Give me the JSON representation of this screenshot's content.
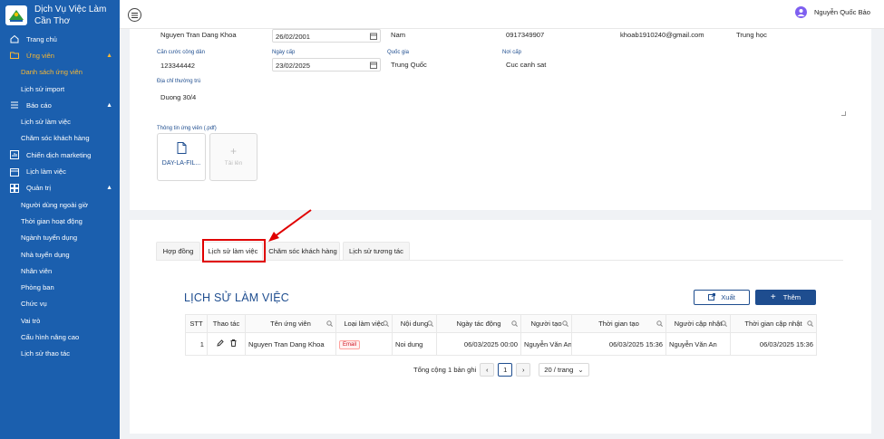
{
  "brand": {
    "line1": "Dịch Vụ Việc Làm",
    "line2": "Cần Thơ"
  },
  "sidebar": {
    "items": [
      {
        "label": "Trang chủ",
        "icon": "home-icon",
        "level": "top"
      },
      {
        "label": "Ứng viên",
        "icon": "folder-icon",
        "level": "top",
        "active": true,
        "caret": "▲"
      },
      {
        "label": "Danh sách ứng viên",
        "level": "sub",
        "active": true
      },
      {
        "label": "Lịch sử import",
        "level": "sub"
      },
      {
        "label": "Báo cáo",
        "icon": "menu-icon",
        "level": "top",
        "caret": "▲"
      },
      {
        "label": "Lịch sử làm việc",
        "level": "sub"
      },
      {
        "label": "Chăm sóc khách hàng",
        "level": "sub"
      },
      {
        "label": "Chiến dịch marketing",
        "icon": "chart-icon",
        "level": "top"
      },
      {
        "label": "Lịch làm việc",
        "icon": "calendar-icon",
        "level": "top"
      },
      {
        "label": "Quản trị",
        "icon": "grid-icon",
        "level": "top",
        "caret": "▲"
      },
      {
        "label": "Người dùng ngoài giờ",
        "level": "sub"
      },
      {
        "label": "Thời gian hoạt động",
        "level": "sub"
      },
      {
        "label": "Ngành tuyển dụng",
        "level": "sub"
      },
      {
        "label": "Nhà tuyển dụng",
        "level": "sub"
      },
      {
        "label": "Nhân viên",
        "level": "sub"
      },
      {
        "label": "Phòng ban",
        "level": "sub"
      },
      {
        "label": "Chức vụ",
        "level": "sub"
      },
      {
        "label": "Vai trò",
        "level": "sub"
      },
      {
        "label": "Cấu hình nâng cao",
        "level": "sub"
      },
      {
        "label": "Lịch sử thao tác",
        "level": "sub"
      }
    ]
  },
  "user": {
    "name": "Nguyễn Quốc Bảo"
  },
  "form": {
    "fullname": "Nguyen Tran Dang Khoa",
    "dob": "26/02/2001",
    "gender": "Nam",
    "phone": "0917349907",
    "email": "khoab1910240@gmail.com",
    "education": "Trung học",
    "id_label": "Căn cước công dân",
    "id_value": "123344442",
    "issue_date_label": "Ngày cấp",
    "issue_date": "23/02/2025",
    "nationality_label": "Quốc gia",
    "nationality": "Trung Quốc",
    "issue_place_label": "Nơi cấp",
    "issue_place": "Cuc canh sat",
    "address_label": "Địa chỉ thường trú",
    "address": "Duong 30/4",
    "file_section_label": "Thông tin ứng viên (.pdf)",
    "file_name": "DAY-LA-FIL...",
    "upload_label": "Tải lên"
  },
  "tabs": [
    {
      "label": "Hợp đồng"
    },
    {
      "label": "Lịch sử làm việc",
      "active": true
    },
    {
      "label": "Chăm sóc khách hàng"
    },
    {
      "label": "Lịch sử tương tác"
    }
  ],
  "history": {
    "title": "LỊCH SỬ LÀM VIỆC",
    "export_label": "Xuất",
    "add_label": "Thêm",
    "columns": [
      "STT",
      "Thao tác",
      "Tên ứng viên",
      "Loại làm việc",
      "Nội dung",
      "Ngày tác động",
      "Người tạo",
      "Thời gian tạo",
      "Người cập nhật",
      "Thời gian cập nhật"
    ],
    "rows": [
      {
        "stt": "1",
        "candidate": "Nguyen Tran Dang Khoa",
        "type": "Email",
        "content": "Noi dung",
        "action_date": "06/03/2025 00:00",
        "creator": "Nguyễn Văn An",
        "created_at": "06/03/2025 15:36",
        "updater": "Nguyễn Văn An",
        "updated_at": "06/03/2025 15:36"
      }
    ],
    "total": "Tổng cộng 1 bản ghi",
    "page": "1",
    "page_size": "20 / trang"
  },
  "colors": {
    "sidebar": "#1b5fae",
    "accent": "#1e4d8f",
    "active": "#f7b733",
    "highlight": "#e00000"
  }
}
